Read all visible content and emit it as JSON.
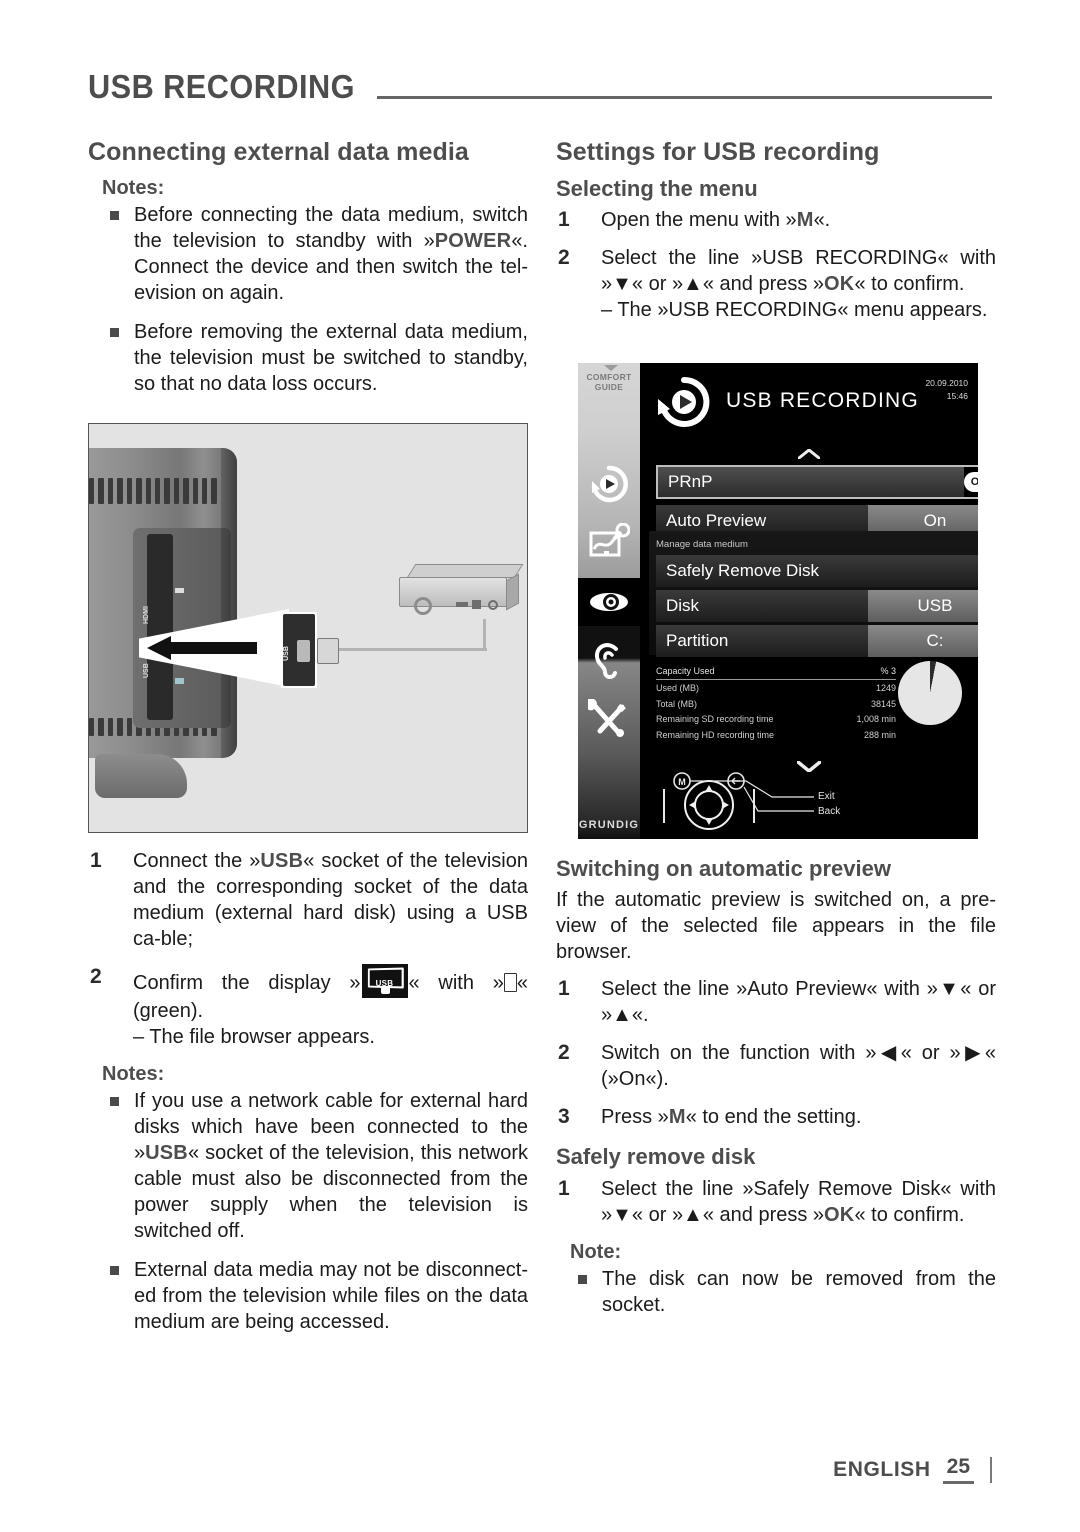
{
  "header": {
    "title": "USB RECORDING"
  },
  "left_column": {
    "section_title": "Connecting external data media",
    "notes_label": "Notes:",
    "notes": [
      {
        "p1": "Before connecting the data medium, switch the television to standby with »",
        "kw": "POWER",
        "p2": "«. Connect the device and then switch the tel-evision on again."
      },
      {
        "p1": "Before removing the external data medium, the television must be switched to standby, so that no data loss occurs.",
        "kw": "",
        "p2": ""
      }
    ],
    "figure": {
      "name": "tv-usb-connection-illustration",
      "tv_port_labels": [
        "HDMI",
        "USB"
      ],
      "callout_label": "USB",
      "device_label": "external hard disk"
    },
    "steps": [
      {
        "num": "1",
        "a": "Connect the »",
        "kw": "USB",
        "b": "« socket of the television and the corresponding socket of the data medium (external hard disk) using a USB ca-ble;"
      }
    ],
    "step2": {
      "num": "2",
      "a": "Confirm the display »",
      "icon_label": "USB",
      "b": "« with »",
      "c": "« (green).",
      "result": "– The file browser appears."
    },
    "notes2_label": "Notes:",
    "notes2": [
      {
        "p1": "If you use a network cable for external hard disks which have been connected to the »",
        "kw": "USB",
        "p2": "« socket of the television, this network cable must also be disconnected from the power supply when the television is switched off."
      },
      {
        "p1": "External data media may not be disconnect-ed from the television while files on the data medium are being accessed.",
        "kw": "",
        "p2": ""
      }
    ]
  },
  "right_column": {
    "section_title": "Settings for USB recording",
    "sub1": "Selecting the menu",
    "sub1_steps": [
      {
        "num": "1",
        "a": "Open the menu with »",
        "kw": "M",
        "b": "«.",
        "result": ""
      },
      {
        "num": "2",
        "a": "Select the line »USB RECORDING« with »▼« or »▲« and press »",
        "kw": "OK",
        "b": "« to confirm.",
        "result": "– The »USB RECORDING« menu appears."
      }
    ],
    "sub2": "Switching on automatic preview",
    "sub2_intro": "If the automatic preview is switched on, a pre-view of the selected file appears in the file browser.",
    "sub2_steps": [
      {
        "num": "1",
        "a": "Select the line »Auto Preview« with »▼« or »▲«.",
        "kw": "",
        "b": "",
        "result": ""
      },
      {
        "num": "2",
        "a": "Switch on the function with »◀« or »▶« (»On«).",
        "kw": "",
        "b": "",
        "result": ""
      },
      {
        "num": "3",
        "a": "Press »",
        "kw": "M",
        "b": "« to end the setting.",
        "result": ""
      }
    ],
    "sub3": "Safely remove disk",
    "sub3_steps": [
      {
        "num": "1",
        "a": "Select the line »Safely Remove Disk« with »▼« or »▲« and press »",
        "kw": "OK",
        "b": "« to confirm.",
        "result": ""
      }
    ],
    "note_label": "Note:",
    "note_text": "The disk can now be removed from the socket."
  },
  "tv_menu": {
    "sidebar": {
      "caption": "COMFORT\nGUIDE",
      "caption_line1": "COMFORT",
      "caption_line2": "GUIDE",
      "icons": [
        "usb-recording-icon",
        "source-connections-icon",
        "eye-picture-icon",
        "ear-sound-icon",
        "tools-settings-icon"
      ],
      "brand": "GRUNDIG"
    },
    "title": "USB RECORDING",
    "date": "20.09.2010",
    "time": "15:46",
    "rows": [
      {
        "label": "PRnP",
        "value": "OK",
        "selected": true,
        "has_value": true
      },
      {
        "label": "Auto Preview",
        "value": "On",
        "selected": false,
        "has_value": true
      }
    ],
    "group_label": "Manage data medium",
    "group_rows": [
      {
        "label": "Safely Remove Disk",
        "value": "",
        "has_value": false
      },
      {
        "label": "Disk",
        "value": "USB",
        "has_value": true
      },
      {
        "label": "Partition",
        "value": "C:",
        "has_value": true
      }
    ],
    "stats": [
      {
        "label": "Capacity Used",
        "value": "% 3"
      },
      {
        "label": "Used (MB)",
        "value": "1249"
      },
      {
        "label": "Total (MB)",
        "value": "38145"
      },
      {
        "label": "Remaining SD recording time",
        "value": "1,008 min"
      },
      {
        "label": "Remaining HD recording time",
        "value": "288 min"
      }
    ],
    "nav_labels": {
      "exit": "Exit",
      "back": "Back"
    }
  },
  "chart_data": {
    "type": "pie",
    "title": "Capacity Used",
    "categories": [
      "Used",
      "Free"
    ],
    "values": [
      3,
      97
    ],
    "unit": "%",
    "legend": "none"
  },
  "footer": {
    "language": "ENGLISH",
    "page": "25"
  }
}
